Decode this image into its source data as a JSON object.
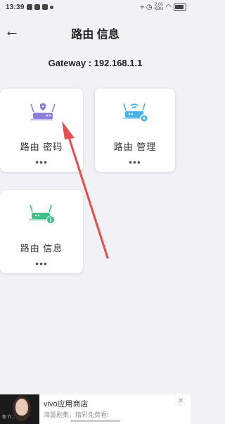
{
  "status_bar": {
    "time": "13:39",
    "network_speed": "2.00",
    "network_unit": "KB/s"
  },
  "header": {
    "back_icon": "←",
    "title": "路由 信息"
  },
  "gateway": {
    "text": "Gateway : 192.168.1.1"
  },
  "cards": [
    {
      "label": "路由 密码",
      "dots": "•••",
      "icon": "router-lock-icon",
      "color": "#8b7fe0"
    },
    {
      "label": "路由 管理",
      "dots": "•••",
      "icon": "router-gear-icon",
      "color": "#47b2e8"
    },
    {
      "label": "路由 信息",
      "dots": "•••",
      "icon": "router-info-icon",
      "color": "#3fbf8c"
    }
  ],
  "annotation": {
    "arrow_color": "#e84c4c"
  },
  "ad": {
    "app_name": "vivo应用商店",
    "subtitle": "海量剧集，精彩免费看!",
    "close_icon": "×",
    "thumb_caption": "你 介..."
  }
}
